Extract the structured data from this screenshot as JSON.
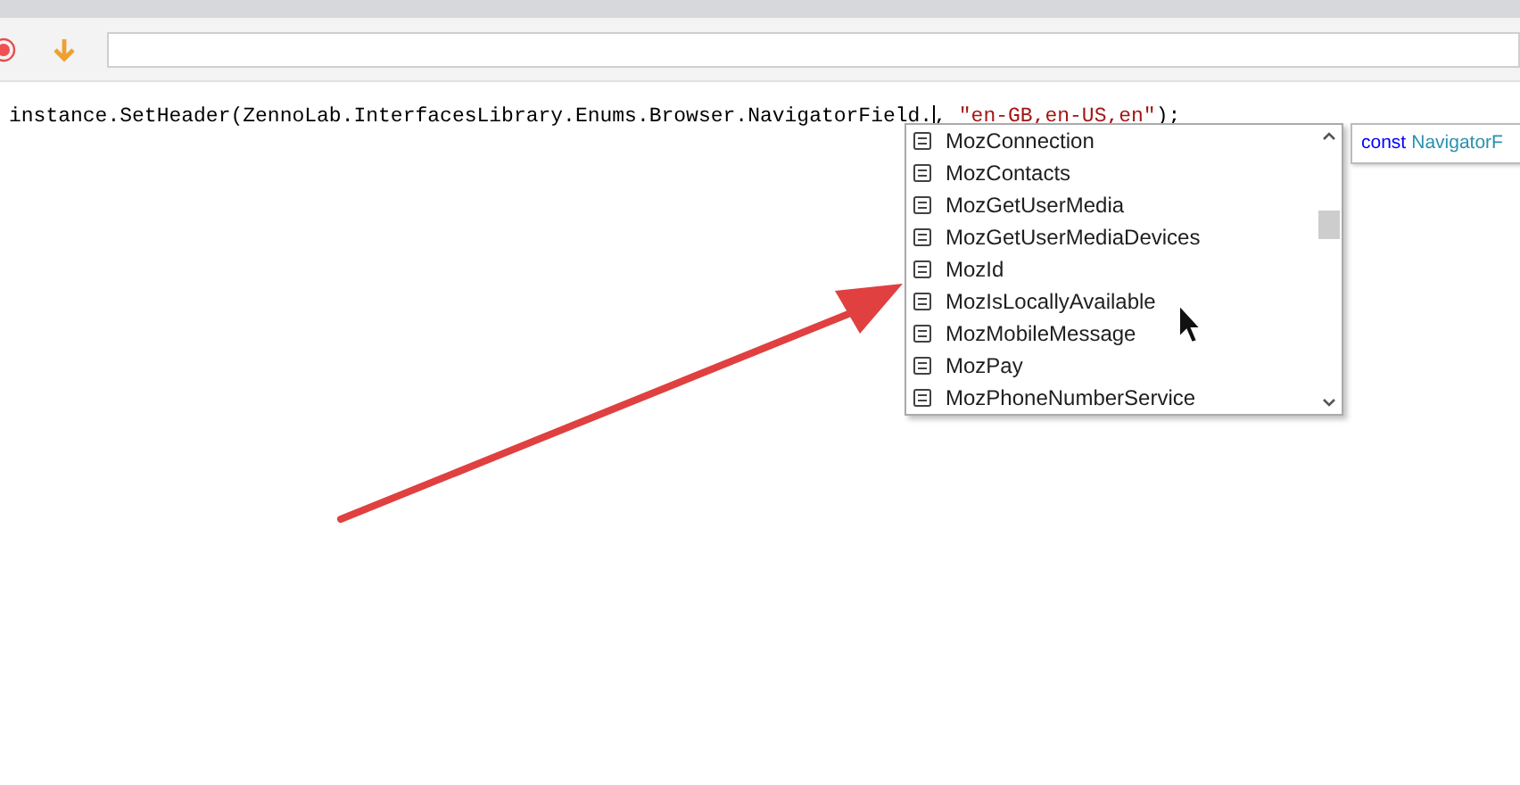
{
  "editor": {
    "code_before": "instance.SetHeader(ZennoLab.InterfacesLibrary.Enums.Browser.NavigatorField.",
    "code_sep": ", ",
    "code_string": "\"en-GB,en-US,en\"",
    "code_end": ");"
  },
  "completion": {
    "items": [
      "MozConnection",
      "MozContacts",
      "MozGetUserMedia",
      "MozGetUserMediaDevices",
      "MozId",
      "MozIsLocallyAvailable",
      "MozMobileMessage",
      "MozPay",
      "MozPhoneNumberService"
    ]
  },
  "tooltip": {
    "keyword": "const",
    "name": "NavigatorF"
  }
}
